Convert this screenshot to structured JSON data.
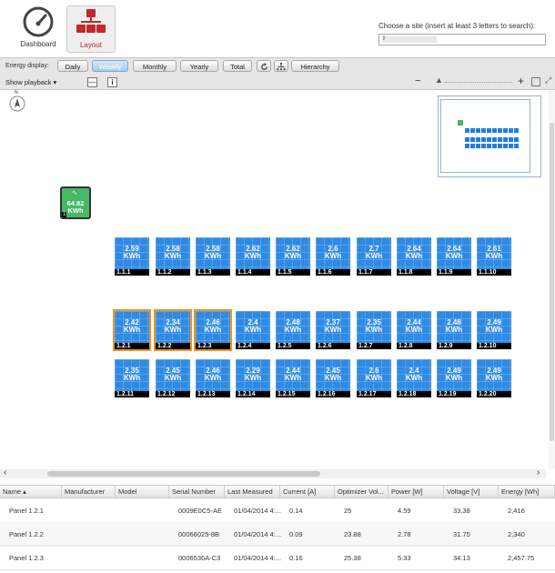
{
  "header": {
    "dashboard_label": "Dashboard",
    "layout_label": "Layout",
    "site_label": "Choose a site (insert at least 3 letters to search):",
    "site_value": "I"
  },
  "toolbar": {
    "energy_label": "Energy display:",
    "buttons": [
      "Daily",
      "Weekly",
      "Monthly",
      "Yearly",
      "Total"
    ],
    "active": "Weekly",
    "hierarchy_label": "Hierarchy",
    "playback_label": "Show playback ▾",
    "minus_label": "—",
    "info_label": "i"
  },
  "compass": {
    "label": "N"
  },
  "inverter": {
    "value": "64.82",
    "unit": "KWh",
    "index": "1"
  },
  "panels_row1": [
    {
      "id": "1.1.1",
      "v": "2.59"
    },
    {
      "id": "1.1.2",
      "v": "2.58"
    },
    {
      "id": "1.1.3",
      "v": "2.58"
    },
    {
      "id": "1.1.4",
      "v": "2.62"
    },
    {
      "id": "1.1.5",
      "v": "2.62"
    },
    {
      "id": "1.1.6",
      "v": "2.6"
    },
    {
      "id": "1.1.7",
      "v": "2.7"
    },
    {
      "id": "1.1.8",
      "v": "2.64"
    },
    {
      "id": "1.1.9",
      "v": "2.64"
    },
    {
      "id": "1.1.10",
      "v": "2.61"
    }
  ],
  "panels_row2": [
    {
      "id": "1.2.1",
      "v": "2.42"
    },
    {
      "id": "1.2.2",
      "v": "2.34"
    },
    {
      "id": "1.2.3",
      "v": "2.46"
    },
    {
      "id": "1.2.4",
      "v": "2.4"
    },
    {
      "id": "1.2.5",
      "v": "2.48"
    },
    {
      "id": "1.2.6",
      "v": "2.37"
    },
    {
      "id": "1.2.7",
      "v": "2.35"
    },
    {
      "id": "1.2.8",
      "v": "2.44"
    },
    {
      "id": "1.2.9",
      "v": "2.48"
    },
    {
      "id": "1.2.10",
      "v": "2.49"
    }
  ],
  "panels_row3": [
    {
      "id": "1.2.11",
      "v": "2.35"
    },
    {
      "id": "1.2.12",
      "v": "2.45"
    },
    {
      "id": "1.2.13",
      "v": "2.46"
    },
    {
      "id": "1.2.14",
      "v": "2.29"
    },
    {
      "id": "1.2.15",
      "v": "2.44"
    },
    {
      "id": "1.2.16",
      "v": "2.45"
    },
    {
      "id": "1.2.17",
      "v": "2.6"
    },
    {
      "id": "1.2.18",
      "v": "2.4"
    },
    {
      "id": "1.2.19",
      "v": "2.49"
    },
    {
      "id": "1.2.20",
      "v": "2.49"
    }
  ],
  "panel_unit": "KWh",
  "selected_panels": [
    "1.2.1",
    "1.2.2",
    "1.2.3"
  ],
  "colors": {
    "panel": "#2f8ae4",
    "selected_outline": "#f0931f",
    "inverter": "#46b965",
    "active_button": "#a8cbea"
  },
  "table": {
    "columns": [
      "Name ▴",
      "Manufacturer",
      "Model",
      "Serial Number",
      "Last Measured",
      "Current [A]",
      "Optimizer Vol...",
      "Power [W]",
      "Voltage [V]",
      "Energy [Wh]"
    ],
    "rows": [
      [
        "Panel 1.2.1",
        "",
        "",
        "0009E0C5-AE",
        "01/04/2014 4:...",
        "0.14",
        "25",
        "4.59",
        "33.38",
        "2,416"
      ],
      [
        "Panel 1.2.2",
        "",
        "",
        "00066025-8B",
        "01/04/2014 4:...",
        "0.09",
        "23.88",
        "2.78",
        "31.75",
        "2,340"
      ],
      [
        "Panel 1.2.3",
        "",
        "",
        "0006536A-C3",
        "01/04/2014 4:...",
        "0.16",
        "25.38",
        "5.33",
        "34.13",
        "2,457.75"
      ]
    ]
  }
}
